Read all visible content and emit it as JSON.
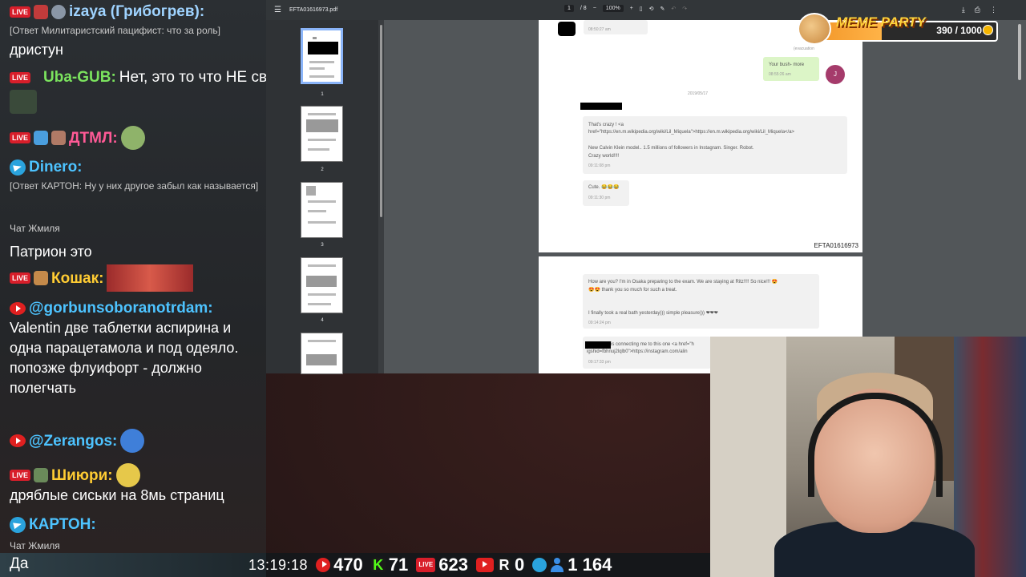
{
  "chat": {
    "messages": [
      {
        "nick": "izaya (Грибогрев):",
        "quote": "[Ответ Милитаристский пацифист: что за роль]",
        "text": "дристун",
        "nick_color": "#9fd3ff"
      },
      {
        "nick": "Uba-GUB:",
        "text": "Нет, это то что НЕ связано",
        "nick_color": "#7be35e"
      },
      {
        "nick": "ДТМЛ:",
        "text": "",
        "nick_color": "#ff5a96"
      },
      {
        "nick": "Dinero:",
        "quote": "[Ответ КАРТОН: Ну у них другое забыл как называется]",
        "nick_color": "#4dc3ff"
      },
      {
        "source": "Чат Жмиля",
        "text": "Патрион это"
      },
      {
        "nick": "Кошак:",
        "text": "",
        "nick_color": "#ffcc33"
      },
      {
        "nick": "@gorbunsoboranotrdam:",
        "text": "Valentin две таблетки аспирина и одна парацетамола и под одеяло. попозже флуифорт - должно полегчать",
        "nick_color": "#4dc3ff"
      },
      {
        "nick": "@Zerangos:",
        "text": "",
        "nick_color": "#4dc3ff"
      },
      {
        "nick": "Шиюри:",
        "text": "дряблые сиськи на 8мь страниц",
        "nick_color": "#ffcc33"
      },
      {
        "nick": "КАРТОН:",
        "source": "Чат Жмиля",
        "nick_color": "#4dc3ff"
      }
    ],
    "input_text": "Да",
    "live_badge": "LIVE"
  },
  "pdf": {
    "filename": "EFTA01616973.pdf",
    "page_current": "1",
    "page_total": "/ 8",
    "zoom": "100%",
    "thumbs": [
      "1",
      "2",
      "3",
      "4"
    ],
    "page1": {
      "time_top": "08:50:27 am",
      "evacuation": "(evacuation",
      "my_msg": "Your bush- more",
      "my_time": "08:55:26 am",
      "avatar_letter": "J",
      "date": "2019/05/17",
      "msg_line1": "That's crazy ! <a",
      "msg_line2": "href=\"https://en.m.wikipedia.org/wiki/Lil_Miquela\">https://en.m.wikipedia.org/wiki/Lil_Miquela</a>",
      "msg_line3": "New Calvin Klein model.. 1.5 millions of followers in Instagram. Singer. Robot.",
      "msg_line4": "Crazy world!!!!",
      "msg_time": "09:11:08 pm",
      "cute": "Cute. 😂😂😂",
      "cute_time": "09:11:30 pm",
      "doc_id": "EFTA01616973"
    },
    "page2": {
      "line1": "How are you? I'm in Osaka preparing  to the exam. We are staying at Ritz!!!! So nice!!! 😍",
      "line2": "😍😍 thank you so much for such a treat.",
      "line3": "I finally took a real bath yesterday))) simple pleasure))) ❤❤❤",
      "time1": "09:14:24 pm",
      "line4": "is connecting me to this one <a href=\"h",
      "line5": "igshid=fbhnuj2lqlb0\">https://instagram.com/alin",
      "time2": "09:17:33 pm"
    }
  },
  "meme_party": {
    "title": "MEME PARTY",
    "count": "390 / 1000",
    "progress_fraction": 0.39
  },
  "status": {
    "time": "13:19:18",
    "youtube": "470",
    "kick": "71",
    "vk": "623",
    "vk_label": "LIVE",
    "rutube": "0",
    "total": "1 164",
    "rutube_letter": "R",
    "kick_letter": "K"
  }
}
